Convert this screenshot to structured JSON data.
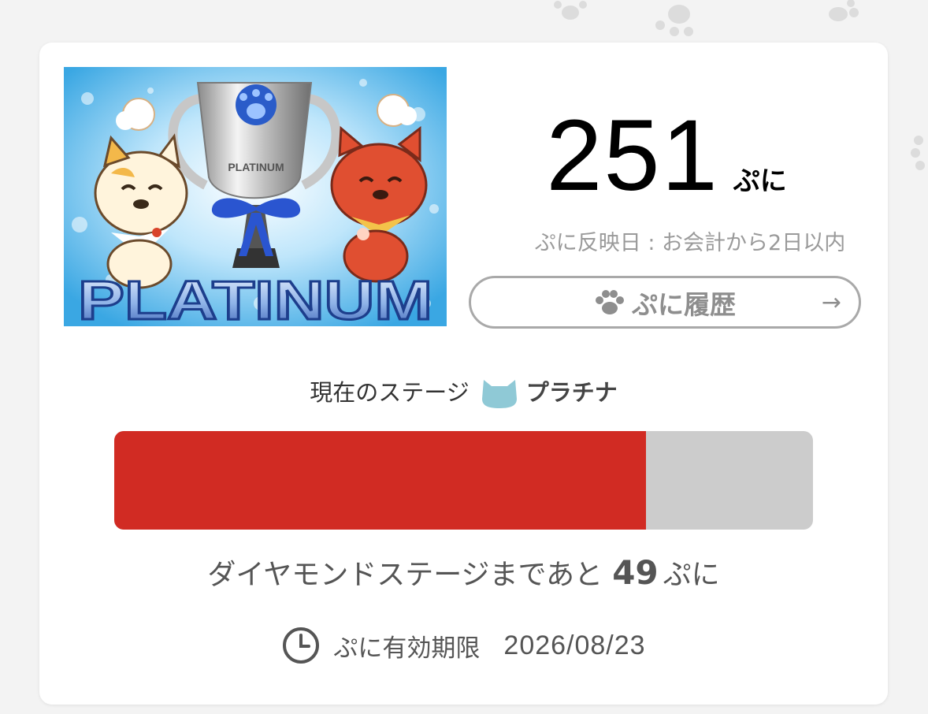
{
  "banner": {
    "trophy_text": "PLATINUM",
    "title": "PLATINUM"
  },
  "points": {
    "value": "251",
    "unit": "ぷに",
    "reflect_note": "ぷに反映日 : お会計から2日以内"
  },
  "history_button": {
    "label": "ぷに履歴",
    "icon": "paw-icon",
    "arrow": "→"
  },
  "stage": {
    "label": "現在のステージ",
    "icon": "cat-icon",
    "name": "プラチナ"
  },
  "progress": {
    "fraction": 0.761,
    "fill_color": "#d12b23",
    "track_color": "#cccccc"
  },
  "remaining": {
    "prefix": "ダイヤモンドステージまであと",
    "value": "49",
    "unit": "ぷに"
  },
  "expiry": {
    "icon": "clock-icon",
    "label": "ぷに有効期限",
    "date": "2026/08/23"
  }
}
